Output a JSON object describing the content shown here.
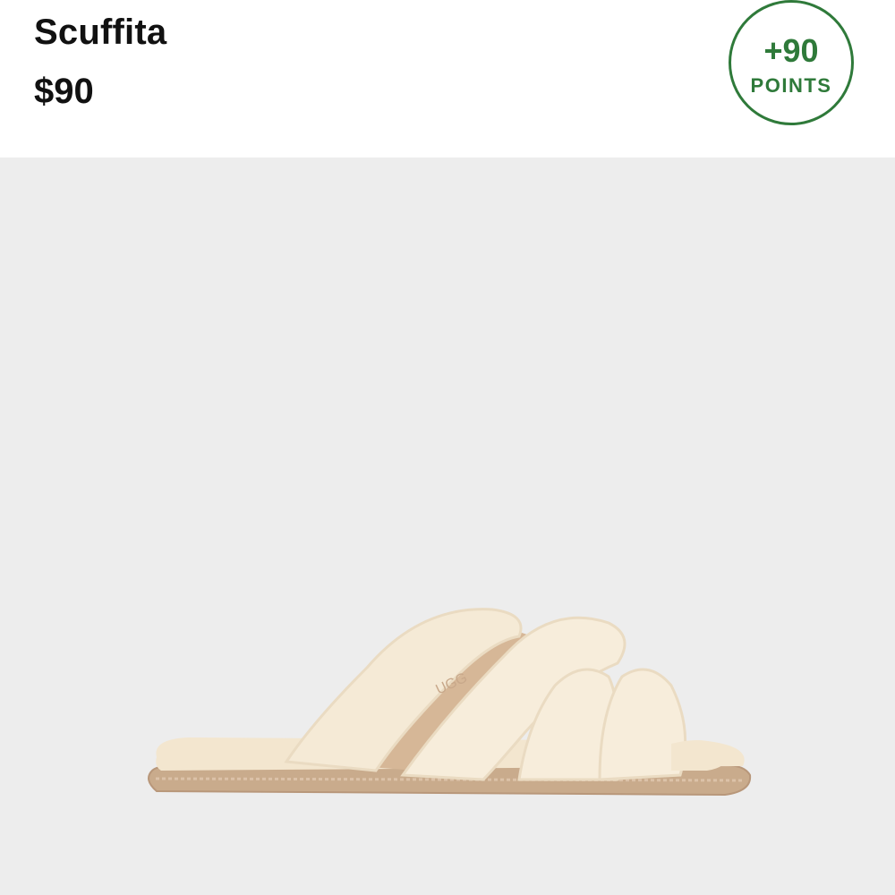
{
  "product": {
    "name": "Scuffita",
    "price": "$90"
  },
  "points_badge": {
    "value": "+90",
    "label": "POINTS",
    "color": "#2f7a3a"
  },
  "image": {
    "subject": "slipper-icon",
    "logo_text": "UGG"
  }
}
